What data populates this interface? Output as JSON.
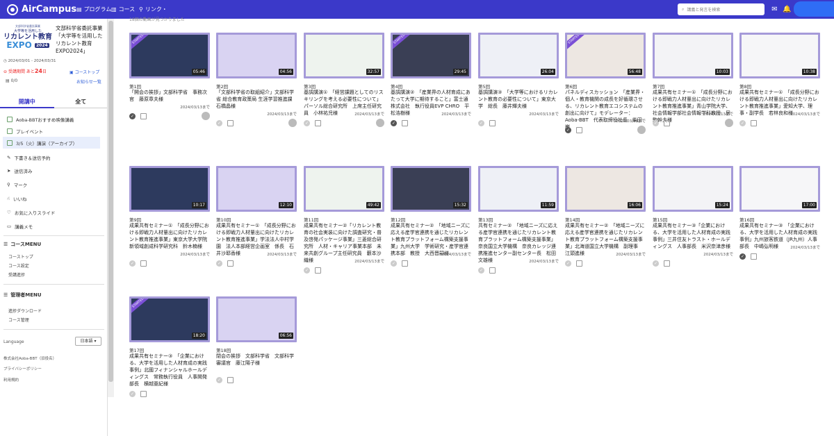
{
  "header": {
    "logo": "AirCampus",
    "nav": [
      {
        "label": "プログラム",
        "icon": "doc-icon"
      },
      {
        "label": "コース",
        "icon": "book-icon"
      },
      {
        "label": "リンク・",
        "icon": "link-icon"
      }
    ],
    "search_placeholder": "講義と発言を検索"
  },
  "sidebar": {
    "expo": {
      "small": "文部科学省委託事業",
      "line1": "大学等を活用した",
      "line2": "リカレント教育",
      "line3": "EXPO",
      "year": "2024"
    },
    "event_title": "文部科学省委託事業「大学等を活用したリカレント教育EXPO2024」",
    "dates": "2024/03/01 - 2024/03/31",
    "deadline_prefix": "受講期間 あと",
    "deadline_days": "24",
    "deadline_suffix": "日",
    "coursetop": "コーストップ",
    "count": "0/0",
    "notices": "お知らせ一覧",
    "tabs": [
      "開講中",
      "全て"
    ],
    "menu": [
      "Aoba-BBTおすすめ映像講義",
      "プレイベント",
      "3/5（火）講演（アーカイブ）",
      "下書き＆送信予約",
      "送信済み",
      "マーク",
      "いいね",
      "お気に入りスライド",
      "講義メモ"
    ],
    "course_menu": "コースMENU",
    "course_items": [
      "コーストップ",
      "コース設定",
      "受講進捗"
    ],
    "admin_menu": "管理者MENU",
    "admin_items": [
      "進捗ダウンロード",
      "コース管理"
    ],
    "language": "Language",
    "lang_value": "日本語",
    "footer": [
      "株式会社Aoba-BBT（旧役名）",
      "プライバシーポリシー",
      "利用規約"
    ]
  },
  "main": {
    "note": "18個の動画が見つかりました",
    "cards": [
      {
        "num": "第1回",
        "title": "「開会の挨拶」文部科学省　事務次官　藤原章夫様",
        "date": "2024/03/13まで",
        "dur": "05:46",
        "done": true,
        "started": true,
        "avatar": true
      },
      {
        "num": "第2回",
        "title": "「文部科学省の取組紹介」文部科学省 総合教育政策局 生涯学習推進課　石橋晶様",
        "date": "2024/03/13まで",
        "dur": "04:56",
        "done": false,
        "started": false,
        "avatar": true
      },
      {
        "num": "第3回",
        "title": "基調講演①　「経営課題としてのリスキリングを考える必要性について」　パーソル総合研究所　上席主任研究員　小林祐児様",
        "date": "2024/03/13まで",
        "dur": "32:57",
        "done": false,
        "started": false,
        "avatar": true
      },
      {
        "num": "第4回",
        "title": "基調講演②　「産業界の人材育成にあたって大学に期待すること」富士通株式会社　執行役員EVP CHRO　平松浩樹様",
        "date": "2024/03/13まで",
        "dur": "29:45",
        "done": true,
        "started": true,
        "avatar": false
      },
      {
        "num": "第5回",
        "title": "基調講演③　「大学等におけるリカレント教育の必要性について」東京大学　総長　藤井輝夫様",
        "date": "2024/03/13まで",
        "dur": "26:04",
        "done": false,
        "started": false,
        "avatar": false
      },
      {
        "num": "第6回",
        "title": "パネルディスカッション　「産業界・個人・教育機関の成長を好循環させる、リカレント教育エコシステムの創出に向けて」モデレーター：Aoba-BBT　代表取締役社長　柴田巌",
        "date": "2024/03/13まで",
        "dur": "56:48",
        "done": true,
        "started": true,
        "avatar": true
      },
      {
        "num": "第7回",
        "title": "成果共有セミナー①　「成長分野における即戦力人材輩出に向けたリカレント教育推進事業」青山学院大学、社会情報学部社会情報学科教授　居駒幹夫様",
        "date": "2024/03/13まで",
        "dur": "10:03",
        "done": false,
        "started": false,
        "avatar": true
      },
      {
        "num": "第8回",
        "title": "成果共有セミナー①　「成長分野における即戦力人材輩出に向けたリカレント教育推進事業」愛知大学、理事・副学長　若林良和様",
        "date": "2024/03/13まで",
        "dur": "10:38",
        "done": false,
        "started": false,
        "avatar": false
      },
      {
        "num": "第9回",
        "title": "成果共有セミナー①　「成長分野における即戦力人材輩出に向けたリカレント教育推進事業」東京大学大学院　新領域創成科学研究科　鈴木楠様",
        "date": "2024/03/13まで",
        "dur": "10:17",
        "done": false,
        "started": false,
        "avatar": false
      },
      {
        "num": "第10回",
        "title": "成果共有セミナー①　「成長分野における即戦力人材輩出に向けたリカレント教育推進事業」学法法人中村学園　法人本部経営企画室　係長　石井沙耶香様",
        "date": "2024/03/13まで",
        "dur": "12:10",
        "done": false,
        "started": false,
        "avatar": false
      },
      {
        "num": "第11回",
        "title": "成果共有セミナー②「リカレント教育の社会実装に向けた調査研究・普及啓発パッケージ事業」三菱総合研究所　人材・キャリア事業本部　未来共創グループ主任研究員　藪本沙織様",
        "date": "2024/03/13まで",
        "dur": "49:42",
        "done": false,
        "started": false,
        "avatar": false
      },
      {
        "num": "第12回",
        "title": "成果共有セミナー②　「地域ニーズに応える産学官連携を通じたリカレント教育プラットフォーム構築支援事業」九州大学　学術研究・産学官連携本部　教授　大西晋嗣様",
        "date": "2024/03/13まで",
        "dur": "15:32",
        "done": false,
        "started": false,
        "avatar": false
      },
      {
        "num": "第13回",
        "title": "共有セミナー②　「地域ニーズに応える産学官連携を通じたリカレント教育プラットフォーム構築支援事業」奈良国立大学機構　奈良カレッジ連携推進センター副センター長　松田文雄様",
        "date": "2024/03/13まで",
        "dur": "11:59",
        "done": false,
        "started": false,
        "avatar": false
      },
      {
        "num": "第14回",
        "title": "成果共有セミナー②　「地域ニーズに応える産学官連携を通じたリカレント教育プラットフォーム構築支援事業」北海道国立大学機構　副理事　江頭進様",
        "date": "2024/03/13まで",
        "dur": "16:06",
        "done": false,
        "started": false,
        "avatar": false
      },
      {
        "num": "第15回",
        "title": "成果共有セミナー③「企業における、大学を活用した人材育成の実践事例」三井住友トラスト・ホールディングス　人事部長　米沢奈津彦様",
        "date": "2024/03/13まで",
        "dur": "15:24",
        "done": false,
        "started": false,
        "avatar": false
      },
      {
        "num": "第16回",
        "title": "成果共有セミナー③　「企業における、大学を活用した人材育成の実践事例」九州旅客鉄道（JR九州）人事部長　中嶋弘明様",
        "date": "2024/03/13まで",
        "dur": "17:00",
        "done": true,
        "started": false,
        "avatar": false
      },
      {
        "num": "第17回",
        "title": "成果共有セミナー③　「企業における、大学を活用した人材育成の実践事例」北國フィナンシャルホールディングス　常務執行役員　人事開発部長　横越亜紀様",
        "date": "",
        "dur": "18:20",
        "done": false,
        "started": true,
        "avatar": false
      },
      {
        "num": "第18回",
        "title": "閉会の挨拶　文部科学省　文部科学審議官　藤江陽子様",
        "date": "",
        "dur": "06:56",
        "done": false,
        "started": false,
        "avatar": false
      }
    ]
  }
}
